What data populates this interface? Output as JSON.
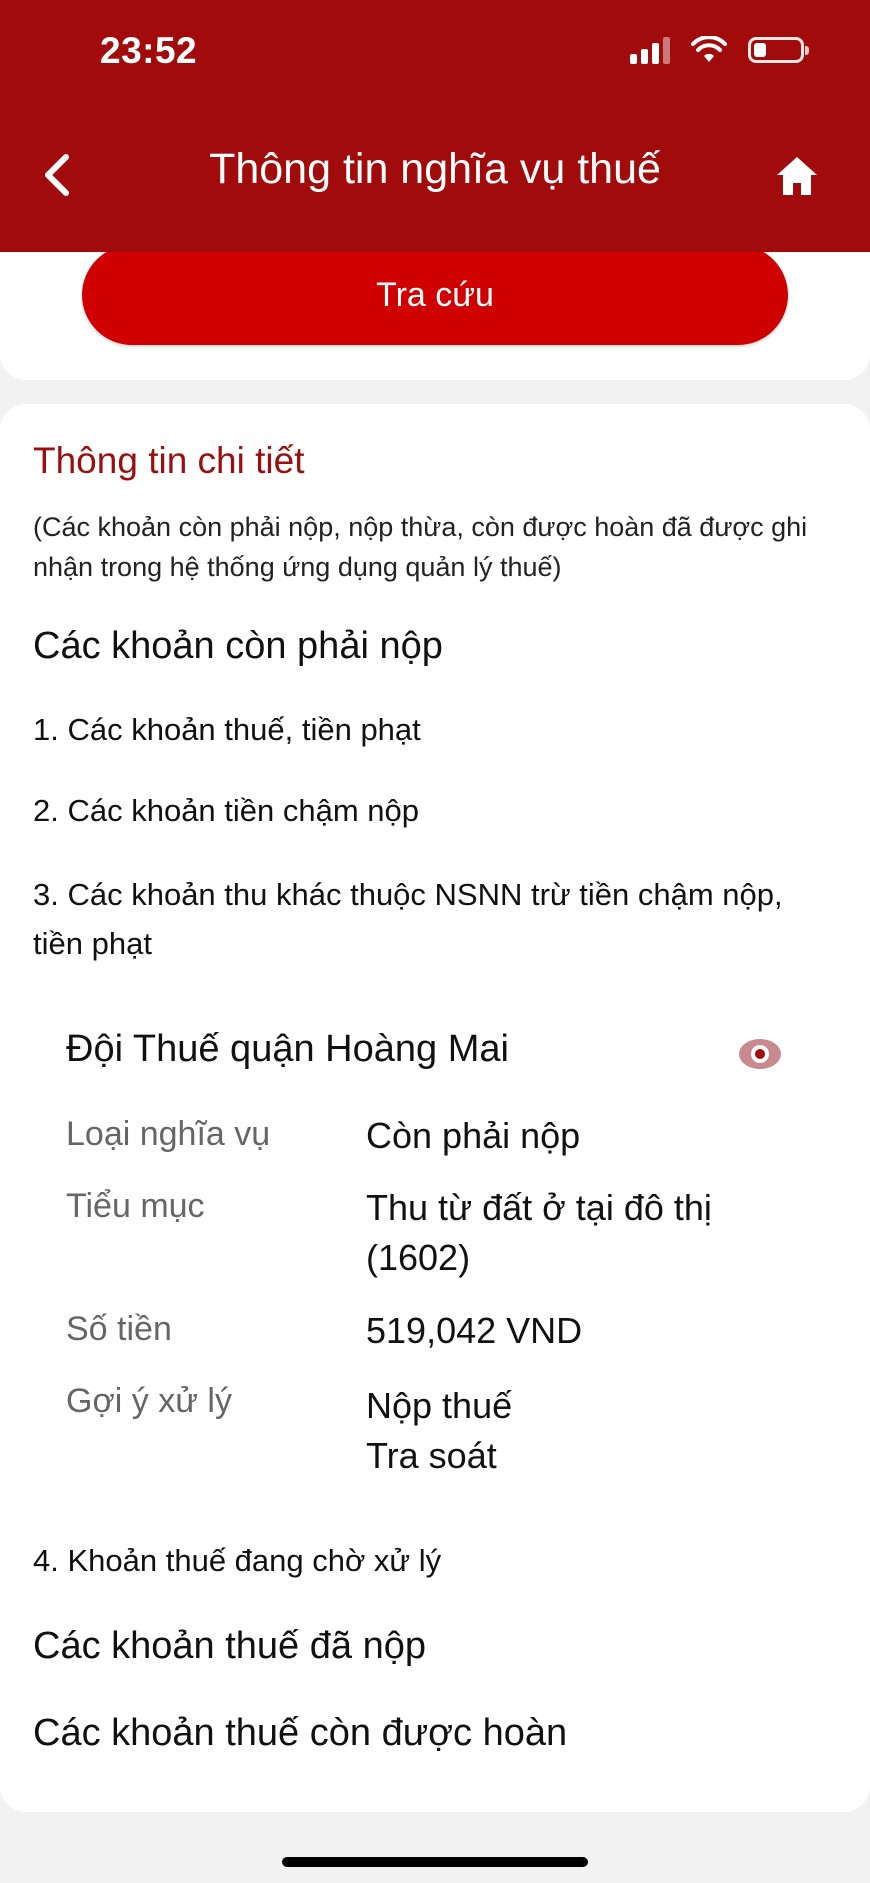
{
  "status_bar": {
    "time": "23:52",
    "icons": [
      "cellular-signal-icon",
      "wifi-icon",
      "battery-icon"
    ],
    "battery_level": 0.25
  },
  "header": {
    "title": "Thông tin nghĩa vụ thuế",
    "back_icon": "chevron-left-icon",
    "home_icon": "home-icon",
    "background": "#a10b0b"
  },
  "search": {
    "button_label": "Tra cứu",
    "button_color": "#d10000"
  },
  "details": {
    "title": "Thông tin chi tiết",
    "note": "(Các khoản còn phải nộp, nộp thừa, còn được hoàn đã được ghi nhận trong hệ thống ứng dụng quản lý thuế)",
    "outstanding_heading": "Các khoản còn phải nộp",
    "items": [
      "1. Các khoản thuế, tiền phạt",
      "2. Các khoản tiền chậm nộp",
      "3. Các khoản thu khác thuộc NSNN trừ tiền chậm nộp, tiền phạt"
    ],
    "record": {
      "office": "Đội Thuế quận Hoàng Mai",
      "view_icon": "eye-icon",
      "rows": [
        {
          "label": "Loại nghĩa vụ",
          "value": "Còn phải nộp"
        },
        {
          "label": "Tiểu mục",
          "value": "Thu từ đất ở tại đô thị (1602)"
        },
        {
          "label": "Số tiền",
          "value": "519,042 VND"
        },
        {
          "label": "Gợi ý xử lý",
          "actions": [
            "Nộp thuế",
            "Tra soát"
          ]
        }
      ]
    },
    "pending": "4. Khoản thuế đang chờ xử lý",
    "paid_heading": "Các khoản thuế đã nộp",
    "refund_heading": "Các khoản thuế còn được hoàn"
  },
  "accent_color": "#9b0f0f"
}
